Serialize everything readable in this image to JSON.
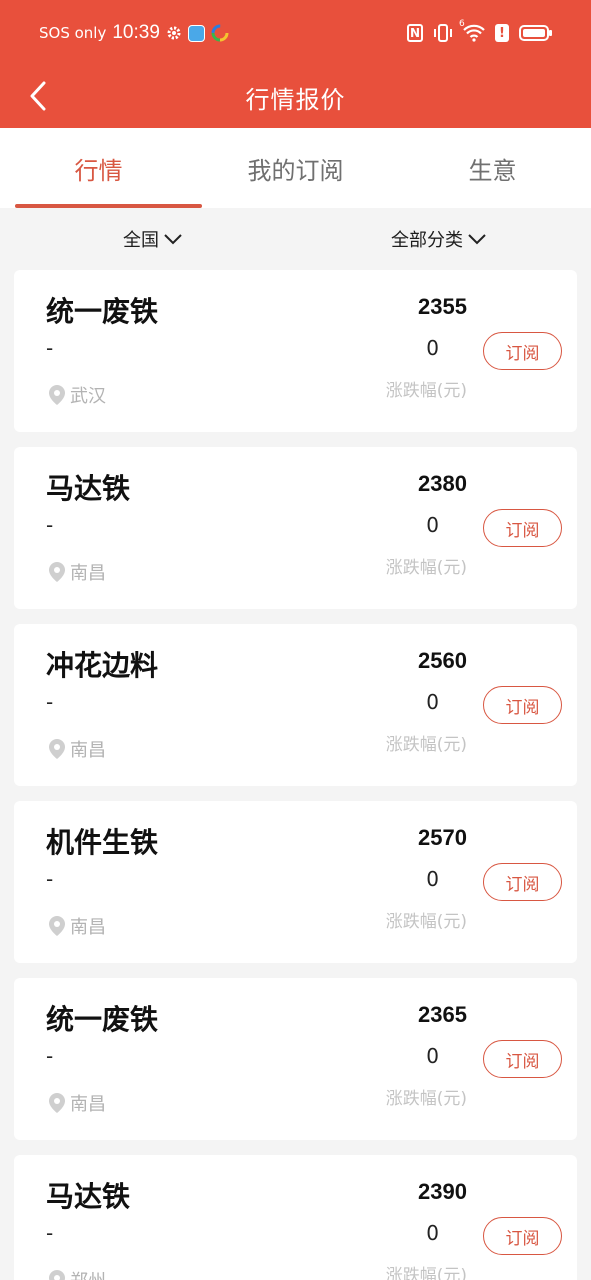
{
  "status_bar": {
    "carrier": "SOS only",
    "time": "10:39",
    "nfc_label": "N",
    "signal_label": "6",
    "alert_label": "!"
  },
  "nav": {
    "title": "行情报价"
  },
  "tabs": [
    {
      "label": "行情",
      "active": true
    },
    {
      "label": "我的订阅",
      "active": false
    },
    {
      "label": "生意",
      "active": false
    }
  ],
  "filters": {
    "region": "全国",
    "category": "全部分类"
  },
  "quotes": [
    {
      "name": "统一废铁",
      "spec": "-",
      "location": "武汉",
      "price": "2355",
      "change": "0",
      "change_label": "涨跌幅(元)",
      "button": "订阅"
    },
    {
      "name": "马达铁",
      "spec": "-",
      "location": "南昌",
      "price": "2380",
      "change": "0",
      "change_label": "涨跌幅(元)",
      "button": "订阅"
    },
    {
      "name": "冲花边料",
      "spec": "-",
      "location": "南昌",
      "price": "2560",
      "change": "0",
      "change_label": "涨跌幅(元)",
      "button": "订阅"
    },
    {
      "name": "机件生铁",
      "spec": "-",
      "location": "南昌",
      "price": "2570",
      "change": "0",
      "change_label": "涨跌幅(元)",
      "button": "订阅"
    },
    {
      "name": "统一废铁",
      "spec": "-",
      "location": "南昌",
      "price": "2365",
      "change": "0",
      "change_label": "涨跌幅(元)",
      "button": "订阅"
    },
    {
      "name": "马达铁",
      "spec": "-",
      "location": "郑州",
      "price": "2390",
      "change": "0",
      "change_label": "涨跌幅(元)",
      "button": "订阅"
    }
  ],
  "colors": {
    "brand": "#e8503c",
    "accent": "#d85742",
    "muted": "#c4c4c4"
  }
}
